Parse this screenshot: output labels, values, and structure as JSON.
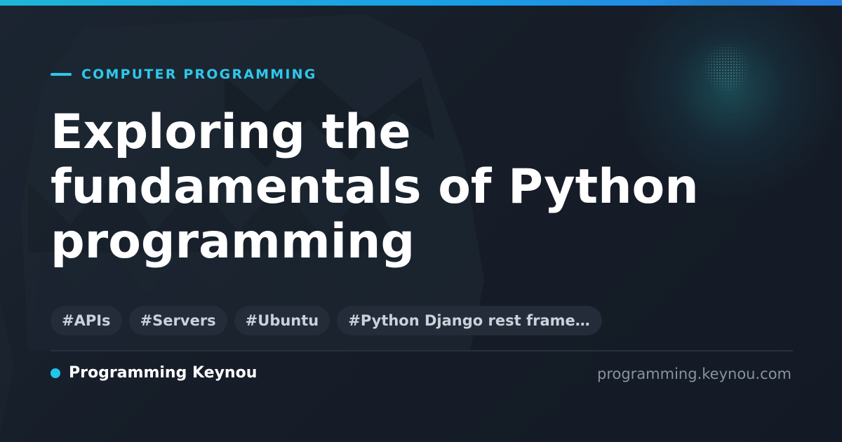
{
  "category": "COMPUTER PROGRAMMING",
  "title_lines": [
    "Exploring the",
    "fundamentals of Python",
    "programming"
  ],
  "tags": [
    "#APIs",
    "#Servers",
    "#Ubuntu",
    "#Python Django rest framework"
  ],
  "brand": {
    "name": "Programming Keynou",
    "domain": "programming.keynou.com"
  },
  "colors": {
    "accent": "#2ec8ea",
    "background": "#161d28",
    "tag_background": "#232c38",
    "title": "#ffffff",
    "muted": "#8793a0"
  }
}
